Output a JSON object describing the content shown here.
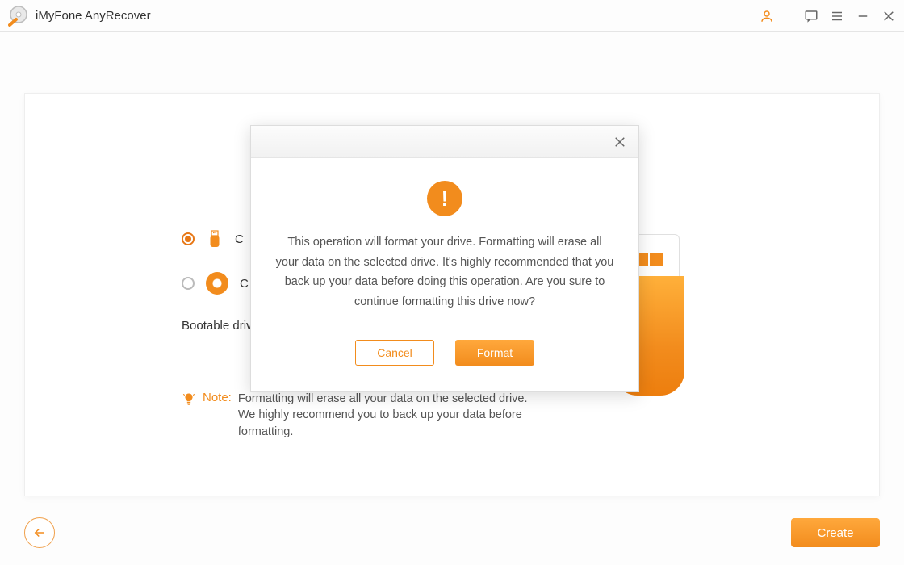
{
  "app": {
    "title": "iMyFone AnyRecover"
  },
  "titlebar_icons": {
    "account": "account-icon",
    "chat": "chat-icon",
    "menu": "menu-icon",
    "minimize": "minimize-icon",
    "close": "close-icon"
  },
  "form": {
    "option_usb_prefix": "C",
    "option_dvd_prefix": "C",
    "bootable_label_prefix": "Bootable driv",
    "note_label": "Note:",
    "note_text": "Formatting will erase all your data on the selected drive. We highly recommend you to back up your data before formatting."
  },
  "footer": {
    "create_label": "Create"
  },
  "modal": {
    "message": "This operation will format your drive. Formatting will erase all your data on the selected drive. It's highly recommended that you back up your data before doing this operation. Are you sure to continue formatting this drive now?",
    "cancel_label": "Cancel",
    "format_label": "Format"
  },
  "colors": {
    "accent": "#f28c1d"
  }
}
